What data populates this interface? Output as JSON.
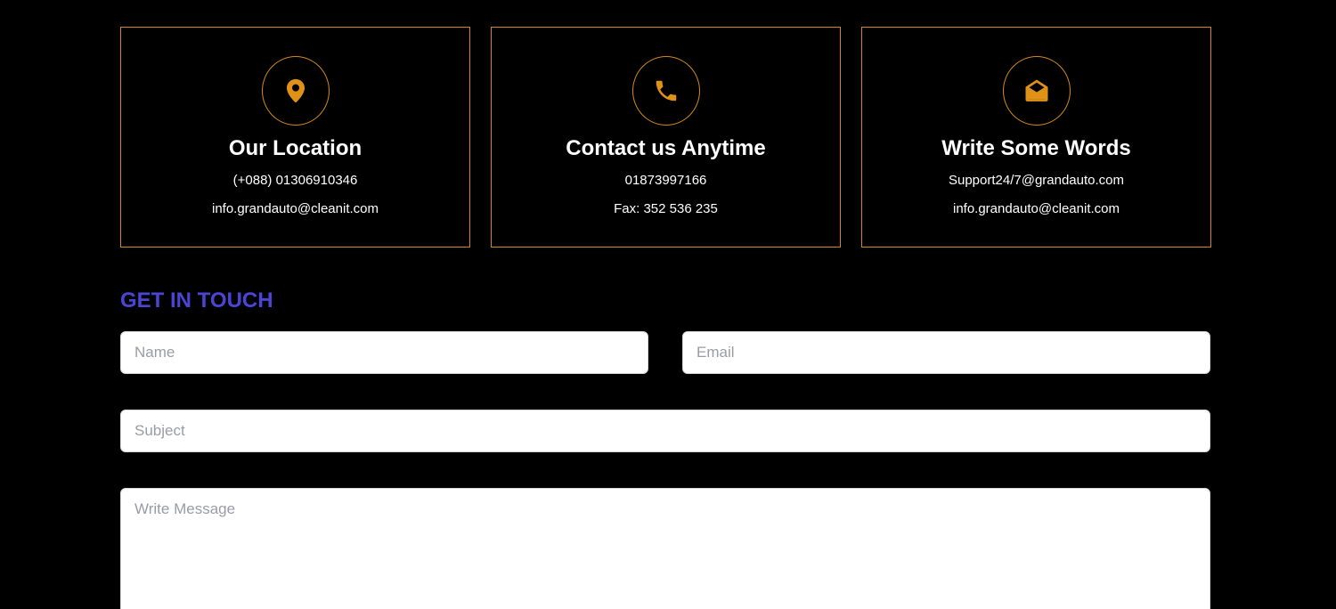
{
  "contact_cards": [
    {
      "icon": "location-pin-icon",
      "title": "Our Location",
      "line1": "(+088) 01306910346",
      "line2": "info.grandauto@cleanit.com"
    },
    {
      "icon": "phone-icon",
      "title": "Contact us Anytime",
      "line1": "01873997166",
      "line2": "Fax: 352 536 235"
    },
    {
      "icon": "envelope-open-icon",
      "title": "Write Some Words",
      "line1": "Support24/7@grandauto.com",
      "line2": "info.grandauto@cleanit.com"
    }
  ],
  "form": {
    "title": "GET IN TOUCH",
    "name_placeholder": "Name",
    "email_placeholder": "Email",
    "subject_placeholder": "Subject",
    "message_placeholder": "Write Message"
  },
  "colors": {
    "accent": "#d4891a",
    "heading": "#4b45d6",
    "background": "#000000"
  }
}
